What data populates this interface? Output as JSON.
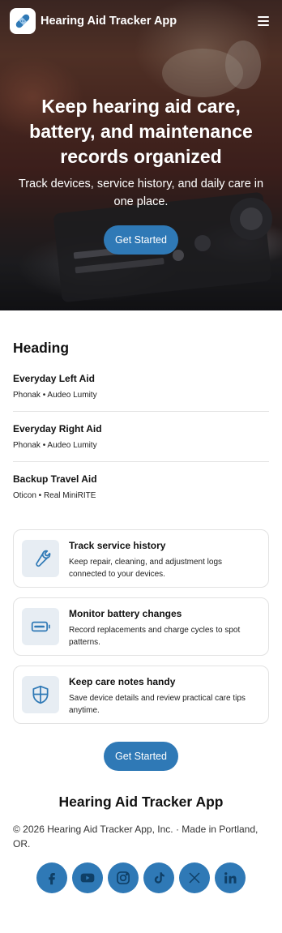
{
  "header": {
    "app_title": "Hearing Aid Tracker App",
    "logo_icon": "bandage-icon",
    "menu_icon": "hamburger-menu-icon"
  },
  "hero": {
    "title": "Keep hearing aid care, battery, and maintenance records organized",
    "subtitle": "Track devices, service history, and daily care in one place.",
    "cta_label": "Get Started"
  },
  "devices": {
    "heading": "Heading",
    "items": [
      {
        "name": "Everyday Left Aid",
        "model": "Phonak • Audeo Lumity"
      },
      {
        "name": "Everyday Right Aid",
        "model": "Phonak • Audeo Lumity"
      },
      {
        "name": "Backup Travel Aid",
        "model": "Oticon • Real MiniRITE"
      }
    ]
  },
  "features": [
    {
      "icon": "wrench-icon",
      "title": "Track service history",
      "text": "Keep repair, cleaning, and adjustment logs connected to your devices."
    },
    {
      "icon": "battery-icon",
      "title": "Monitor battery changes",
      "text": "Record replacements and charge cycles to spot patterns."
    },
    {
      "icon": "shield-icon",
      "title": "Keep care notes handy",
      "text": "Save device details and review practical care tips anytime."
    }
  ],
  "cta": {
    "label": "Get Started"
  },
  "footer": {
    "title": "Hearing Aid Tracker App",
    "copyright": "© 2026 Hearing Aid Tracker App, Inc. · Made in Portland, OR.",
    "socials": [
      "facebook-icon",
      "youtube-icon",
      "instagram-icon",
      "tiktok-icon",
      "x-icon",
      "linkedin-icon"
    ]
  },
  "colors": {
    "accent": "#2f79b6",
    "icon_bg": "#e7edf3"
  }
}
